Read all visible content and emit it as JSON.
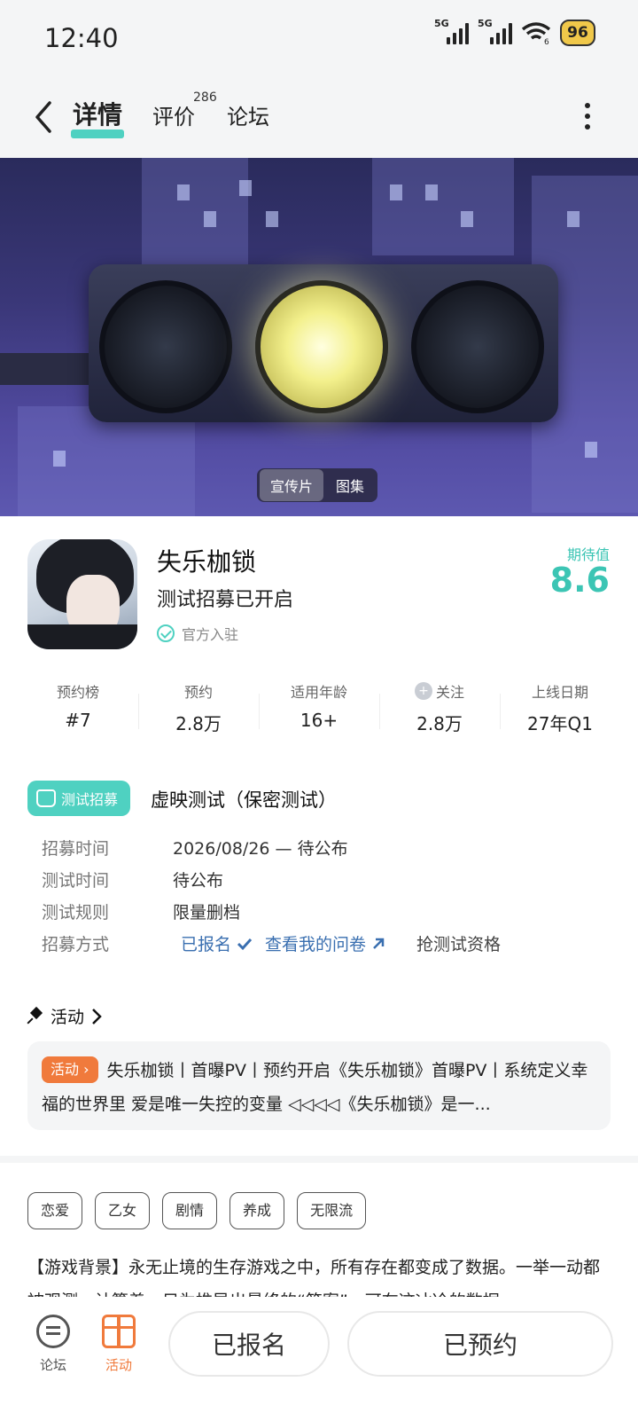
{
  "status_bar": {
    "time": "12:40",
    "network": "5G",
    "wifi_level": "6",
    "battery": "96"
  },
  "nav": {
    "tabs": [
      {
        "label": "详情",
        "active": true
      },
      {
        "label": "评价",
        "count": "286"
      },
      {
        "label": "论坛"
      }
    ]
  },
  "hero": {
    "media_tabs": [
      "宣传片",
      "图集"
    ],
    "selected": "宣传片"
  },
  "game": {
    "title": "失乐枷锁",
    "subtitle": "测试招募已开启",
    "official": "官方入驻",
    "score_label": "期待值",
    "score": "8.6"
  },
  "stats": [
    {
      "label": "预约榜",
      "value": "#7"
    },
    {
      "label": "预约",
      "value": "2.8万"
    },
    {
      "label": "适用年龄",
      "value": "16+"
    },
    {
      "label": "关注",
      "value": "2.8万",
      "icon": "heart-plus-icon"
    },
    {
      "label": "上线日期",
      "value": "27年Q1"
    }
  ],
  "recruit": {
    "badge": "测试招募",
    "title": "虚映测试（保密测试）",
    "rows": [
      {
        "label": "招募时间",
        "value": "2026/08/26 — 待公布"
      },
      {
        "label": "测试时间",
        "value": "待公布"
      },
      {
        "label": "测试规则",
        "value": "限量删档"
      },
      {
        "label": "招募方式"
      }
    ],
    "signed_up": "已报名",
    "questionnaire": "查看我的问卷",
    "grab": "抢测试资格"
  },
  "activity": {
    "header": "活动",
    "tag": "活动",
    "text": "失乐枷锁丨首曝PV丨预约开启《失乐枷锁》首曝PV丨系统定义幸福的世界里 爱是唯一失控的变量 ◁◁◁◁《失乐枷锁》是一..."
  },
  "tags": [
    "恋爱",
    "乙女",
    "剧情",
    "养成",
    "无限流"
  ],
  "description": "【游戏背景】永无止境的生存游戏之中，所有存在都变成了数据。一举一动都被观测、计算着，只为推导出最终的“答案”。可在这冰冷的数据",
  "bottom": {
    "forum": "论坛",
    "activity": "活动",
    "signed_up_btn": "已报名",
    "reserved_btn": "已预约"
  },
  "colors": {
    "accent": "#4fd1c1",
    "orange": "#f07a3c",
    "link": "#3a6fb0"
  }
}
